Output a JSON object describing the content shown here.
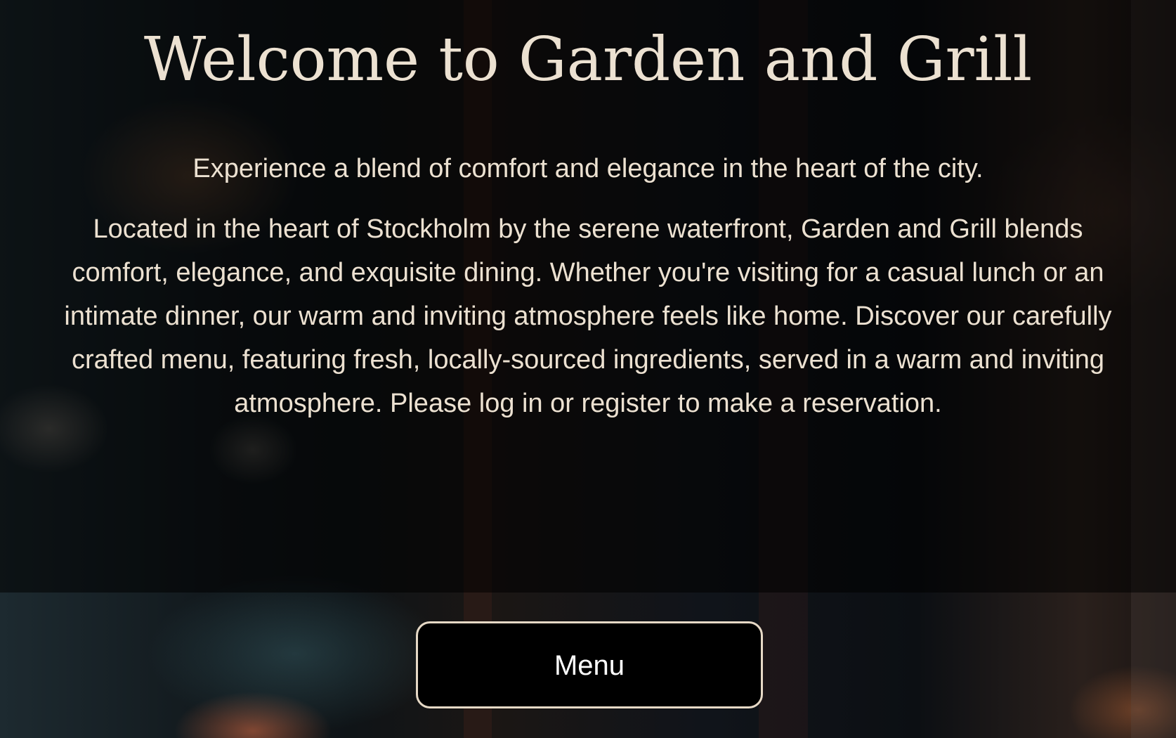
{
  "hero": {
    "title": "Welcome to Garden and Grill",
    "tagline": "Experience a blend of comfort and elegance in the heart of the city.",
    "description": "Located in the heart of Stockholm by the serene waterfront, Garden and Grill blends comfort, elegance, and exquisite dining. Whether you're visiting for a casual lunch or an intimate dinner, our warm and inviting atmosphere feels like home. Discover our carefully crafted menu, featuring fresh, locally-sourced ingredients, served in a warm and inviting atmosphere. Please log in or register to make a reservation."
  },
  "actions": {
    "menu_label": "Menu"
  },
  "colors": {
    "text": "#ece1d1",
    "button_background": "#000000",
    "button_border": "#e6d9c6",
    "button_text": "#ffffff"
  }
}
